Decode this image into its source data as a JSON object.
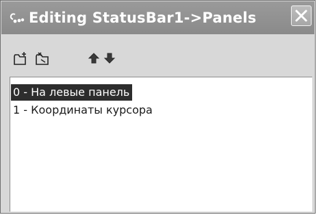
{
  "window": {
    "title": "Editing StatusBar1->Panels"
  },
  "toolbar": {
    "icons": [
      "add-new-panel-icon",
      "delete-panel-icon",
      "move-up-arrow-icon",
      "move-down-arrow-icon"
    ]
  },
  "panels": {
    "items": [
      {
        "label": "0 - На левые панель",
        "selected": true
      },
      {
        "label": "1 - Координаты курсора",
        "selected": false
      }
    ]
  }
}
